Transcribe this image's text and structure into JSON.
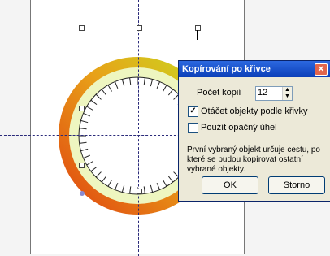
{
  "dialog": {
    "title": "Kopírování po křivce",
    "close_glyph": "✕",
    "count_label": "Počet kopií",
    "count_value": "12",
    "rotate_label": "Otáčet objekty podle křivky",
    "rotate_checked": true,
    "reverse_label": "Použít opačný úhel",
    "reverse_checked": false,
    "info_text": "První vybraný objekt určuje cestu, po které se budou kopírovat ostatní vybrané objekty.",
    "ok_label": "OK",
    "cancel_label": "Storno"
  },
  "canvas": {
    "ring_colors": [
      "#e04010",
      "#c8dc20"
    ],
    "tick_count": 48
  }
}
